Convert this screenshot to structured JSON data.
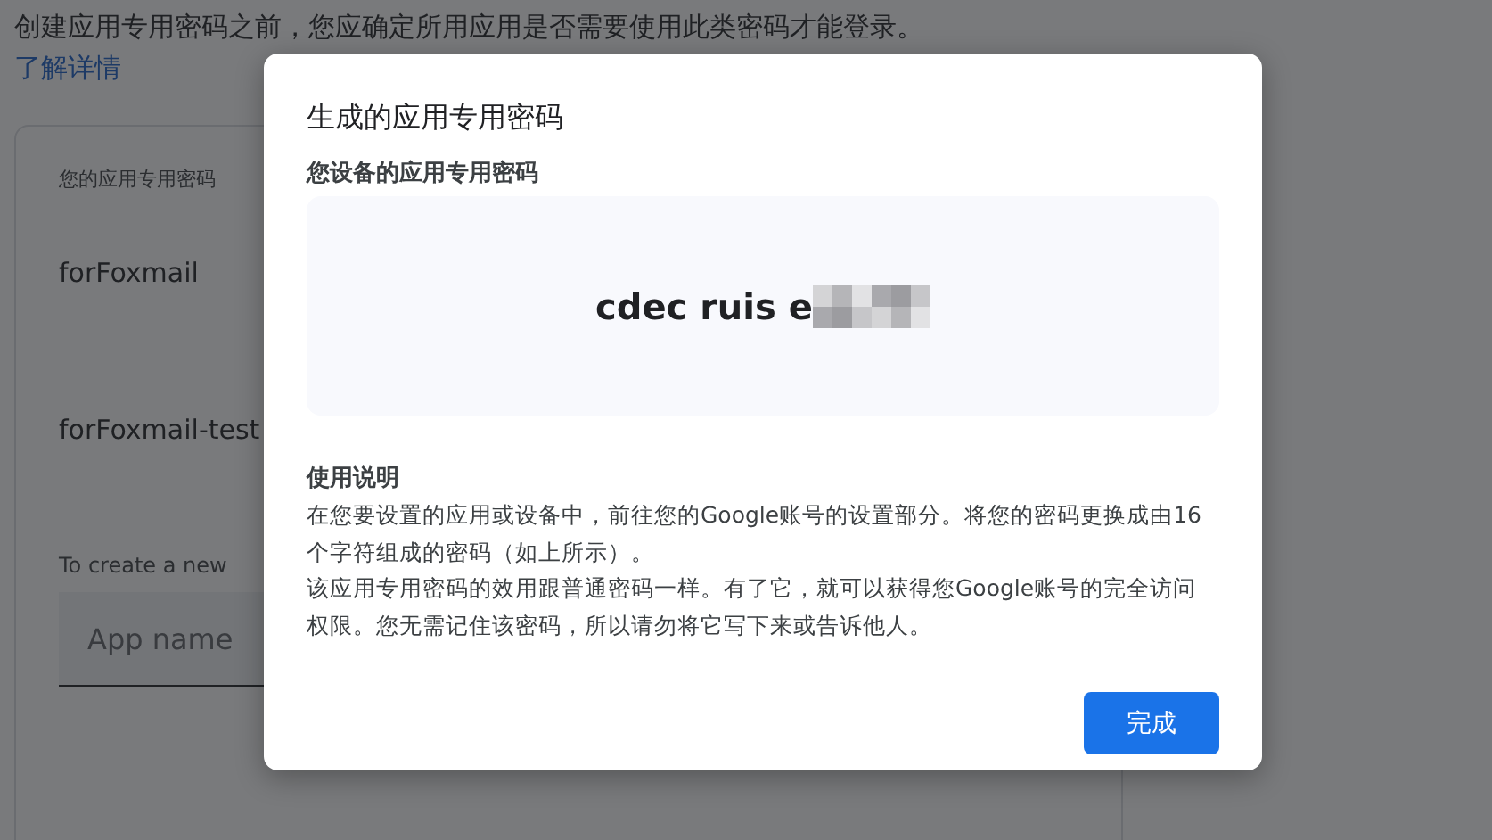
{
  "page": {
    "intro": "创建应用专用密码之前，您应确定所用应用是否需要使用此类密码才能登录。",
    "learn_more": "了解详情",
    "card": {
      "heading": "您的应用专用密码",
      "apps": [
        "forFoxmail",
        "forFoxmail-test"
      ],
      "create_hint": "To create a new",
      "app_name": {
        "placeholder": "App name"
      }
    }
  },
  "dialog": {
    "title": "生成的应用专用密码",
    "password_label": "您设备的应用专用密码",
    "password": "cdec ruis e",
    "password_redacted": true,
    "instructions_heading": "使用说明",
    "instructions": [
      "在您要设置的应用或设备中，前往您的Google账号的设置部分。将您的密码更换成由16个字符组成的密码（如上所示）。",
      "该应用专用密码的效用跟普通密码一样。有了它，就可以获得您Google账号的完全访问权限。您无需记住该密码，所以请勿将它写下来或告诉他人。"
    ],
    "done_button": "完成"
  }
}
